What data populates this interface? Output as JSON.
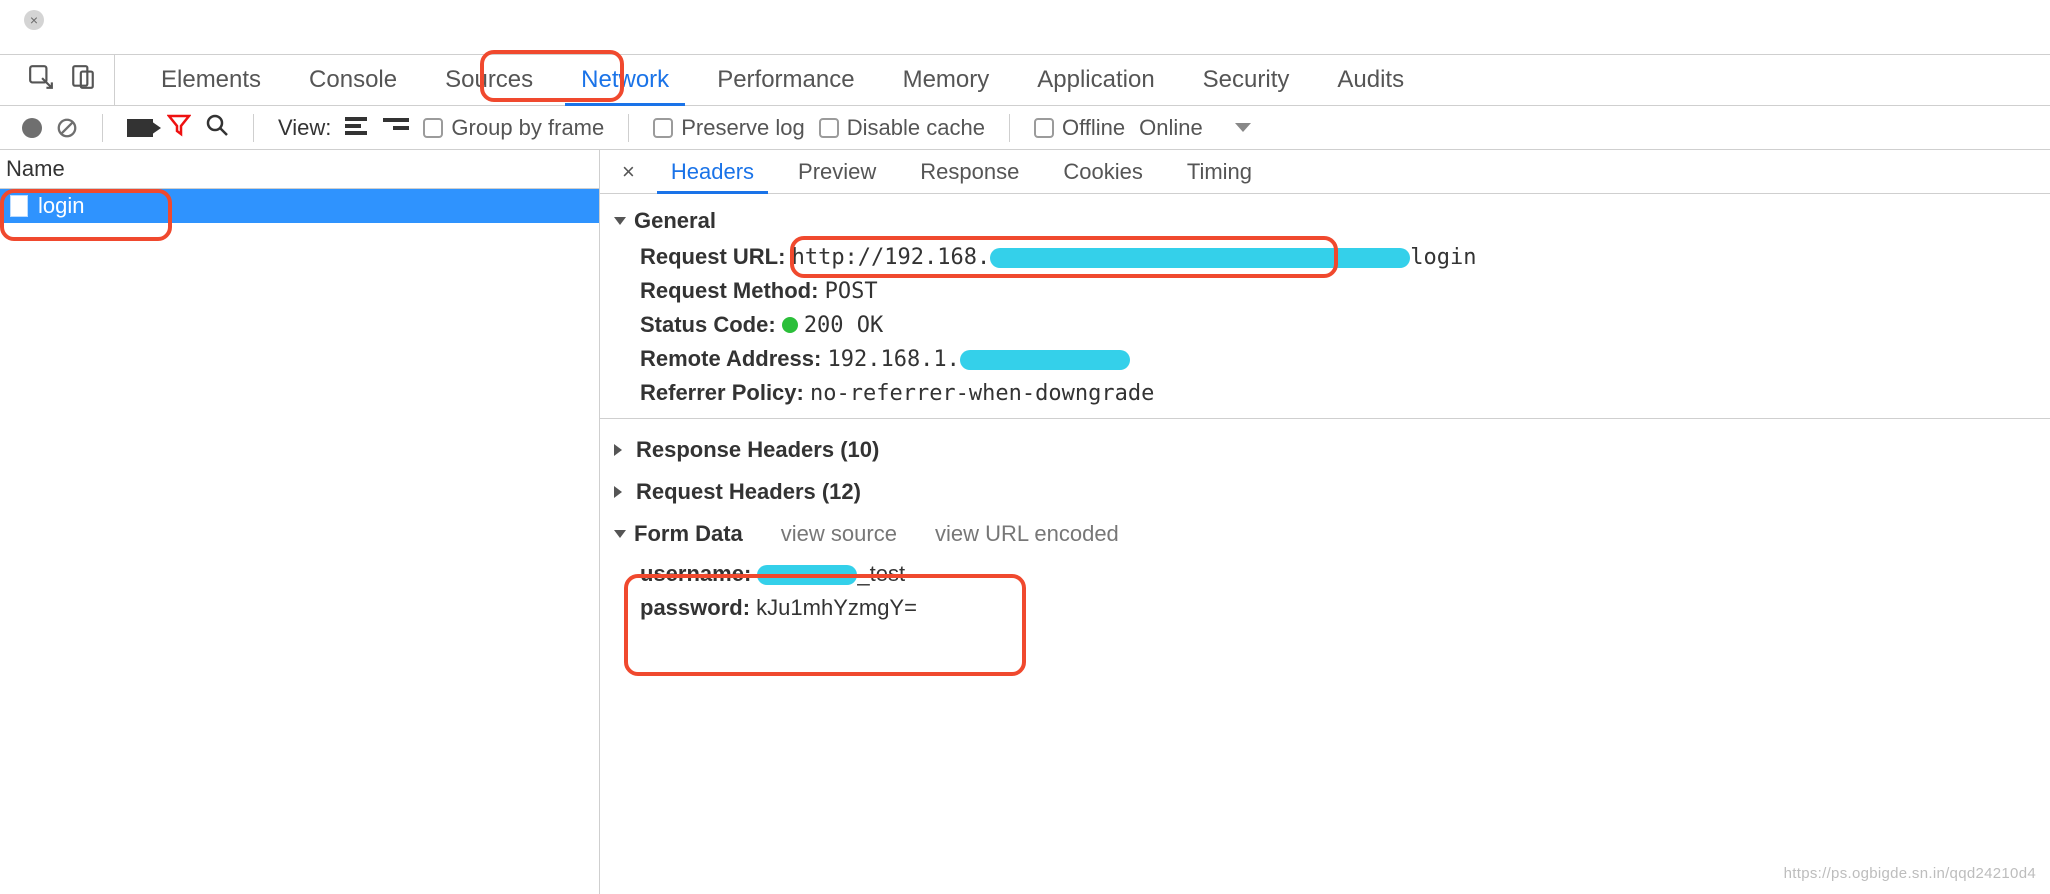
{
  "window": {
    "close_title": "Close"
  },
  "tabs": {
    "elements": "Elements",
    "console": "Console",
    "sources": "Sources",
    "network": "Network",
    "performance": "Performance",
    "memory": "Memory",
    "application": "Application",
    "security": "Security",
    "audits": "Audits"
  },
  "toolbar": {
    "view_label": "View:",
    "group_by_frame": "Group by frame",
    "preserve_log": "Preserve log",
    "disable_cache": "Disable cache",
    "offline": "Offline",
    "online": "Online"
  },
  "left": {
    "name_header": "Name",
    "requests": [
      {
        "name": "login",
        "selected": true
      }
    ]
  },
  "detail_tabs": {
    "headers": "Headers",
    "preview": "Preview",
    "response": "Response",
    "cookies": "Cookies",
    "timing": "Timing"
  },
  "headers": {
    "general_title": "General",
    "request_url_label": "Request URL:",
    "request_url_prefix": "http://192.168.",
    "request_url_suffix": "login",
    "request_method_label": "Request Method:",
    "request_method_value": "POST",
    "status_code_label": "Status Code:",
    "status_code_value": "200 OK",
    "remote_address_label": "Remote Address:",
    "remote_address_prefix": "192.168.1.",
    "referrer_policy_label": "Referrer Policy:",
    "referrer_policy_value": "no-referrer-when-downgrade",
    "response_headers_title": "Response Headers (10)",
    "request_headers_title": "Request Headers (12)",
    "form_data_title": "Form Data",
    "view_source": "view source",
    "view_url_encoded": "view URL encoded",
    "form": {
      "username_label": "username:",
      "username_suffix": "_test",
      "password_label": "password:",
      "password_value": "kJu1mhYzmgY="
    }
  },
  "watermark": "https://ps.ogbigde.sn.in/qqd24210d4"
}
